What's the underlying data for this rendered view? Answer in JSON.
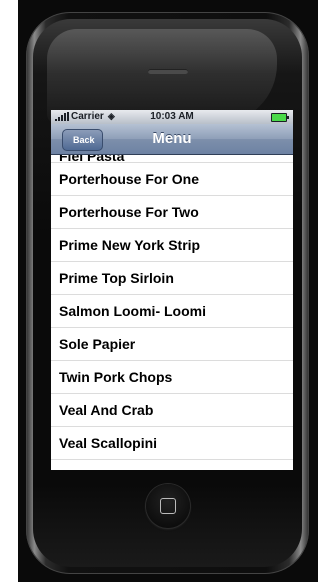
{
  "status_bar": {
    "carrier": "Carrier",
    "time": "10:03 AM",
    "icons": [
      "signal-icon",
      "wifi-icon",
      "battery-icon"
    ]
  },
  "nav_bar": {
    "back_label": "Back",
    "title": "Menu"
  },
  "menu_list": {
    "items": [
      "Fiel Pasta",
      "Porterhouse For One",
      "Porterhouse For Two",
      "Prime New York Strip",
      "Prime Top Sirloin",
      "Salmon Loomi- Loomi",
      "Sole Papier",
      "Twin Pork Chops",
      "Veal And Crab",
      "Veal Scallopini"
    ]
  },
  "colors": {
    "navbar": "#7d8fab",
    "battery": "#4ad94a"
  }
}
